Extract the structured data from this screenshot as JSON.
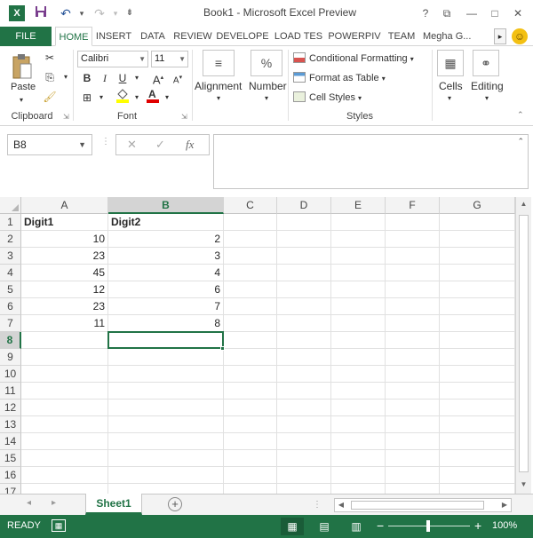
{
  "window": {
    "title": "Book1 - Microsoft Excel Preview",
    "controls": {
      "help": "?",
      "restore": "⧉",
      "minimize": "—",
      "maximize": "□",
      "close": "✕"
    }
  },
  "quick_access": {
    "save_icon": "save-icon",
    "undo_icon": "undo-icon",
    "redo_icon": "redo-icon",
    "customize_icon": "customize-icon"
  },
  "ribbon_tabs": [
    "FILE",
    "HOME",
    "INSERT",
    "DATA",
    "REVIEW",
    "DEVELOPE",
    "LOAD TES",
    "POWERPIV",
    "TEAM"
  ],
  "user": "Megha G...",
  "ribbon": {
    "clipboard": {
      "paste_label": "Paste",
      "group_label": "Clipboard"
    },
    "font": {
      "font_name": "Calibri",
      "font_size": "11",
      "group_label": "Font"
    },
    "alignment": {
      "label": "Alignment"
    },
    "number": {
      "label": "Number",
      "icon_glyph": "%"
    },
    "styles": {
      "conditional_formatting": "Conditional Formatting",
      "format_as_table": "Format as Table",
      "cell_styles": "Cell Styles",
      "group_label": "Styles"
    },
    "cells": {
      "label": "Cells"
    },
    "editing": {
      "label": "Editing"
    }
  },
  "formula_bar": {
    "name_box": "B8",
    "formula": "",
    "fx_label": "fx"
  },
  "grid": {
    "columns": [
      "A",
      "B",
      "C",
      "D",
      "E",
      "F",
      "G"
    ],
    "selected_column": "B",
    "selected_row": 8,
    "active_cell": "B8",
    "rows": [
      {
        "n": "1",
        "a": "Digit1",
        "b": "Digit2"
      },
      {
        "n": "2",
        "a": "10",
        "b": "2"
      },
      {
        "n": "3",
        "a": "23",
        "b": "3"
      },
      {
        "n": "4",
        "a": "45",
        "b": "4"
      },
      {
        "n": "5",
        "a": "12",
        "b": "6"
      },
      {
        "n": "6",
        "a": "23",
        "b": "7"
      },
      {
        "n": "7",
        "a": "11",
        "b": "8"
      },
      {
        "n": "8",
        "a": "",
        "b": ""
      },
      {
        "n": "9",
        "a": "",
        "b": ""
      },
      {
        "n": "10",
        "a": "",
        "b": ""
      },
      {
        "n": "11",
        "a": "",
        "b": ""
      },
      {
        "n": "12",
        "a": "",
        "b": ""
      },
      {
        "n": "13",
        "a": "",
        "b": ""
      },
      {
        "n": "14",
        "a": "",
        "b": ""
      },
      {
        "n": "15",
        "a": "",
        "b": ""
      },
      {
        "n": "16",
        "a": "",
        "b": ""
      },
      {
        "n": "17",
        "a": "",
        "b": ""
      }
    ]
  },
  "sheets": {
    "tabs": [
      "Sheet1"
    ],
    "active": "Sheet1",
    "add_label": "+"
  },
  "status": {
    "text": "READY",
    "zoom": "100%"
  },
  "colors": {
    "accent": "#217346",
    "header_bg": "#f3f3f3",
    "gridline": "#e1e1e1"
  }
}
